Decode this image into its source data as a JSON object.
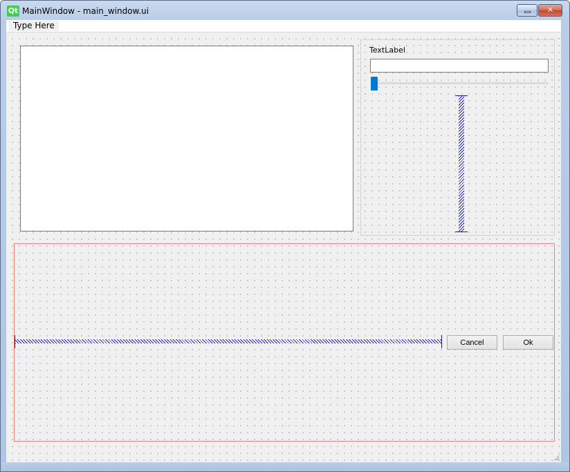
{
  "window": {
    "title": "MainWindow - main_window.ui",
    "app_logo_text": "Qt",
    "minimize_glyph": "",
    "close_glyph": "✕"
  },
  "menubar": {
    "items": [
      {
        "label": "Type Here"
      }
    ]
  },
  "form": {
    "text_label": "TextLabel",
    "line_edit_value": "",
    "slider_value": 0,
    "cancel_label": "Cancel",
    "ok_label": "Ok"
  },
  "colors": {
    "accent": "#0078d7",
    "spacer": "#1a1aa8",
    "layout_border": "#f08080",
    "qt_green": "#41cd52",
    "close_red": "#c6452c"
  },
  "icons": {
    "app": "qt-logo-icon",
    "minimize": "minimize-icon",
    "close": "close-icon",
    "resize": "size-grip-icon"
  }
}
